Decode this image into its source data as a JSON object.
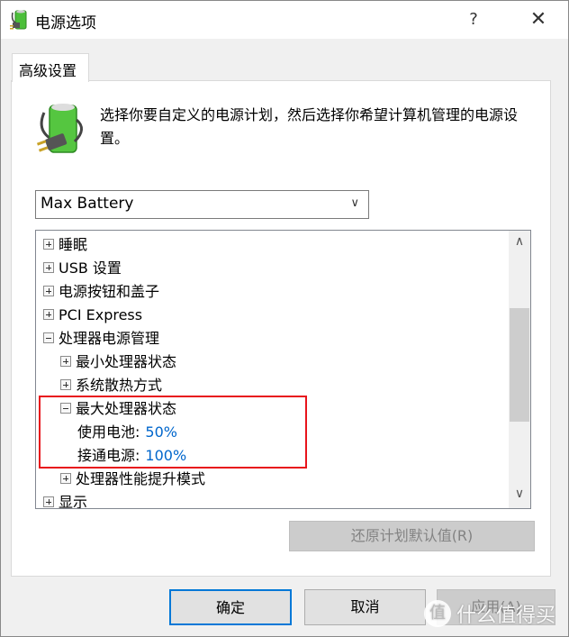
{
  "window": {
    "title": "电源选项",
    "help": "?",
    "close": "✕"
  },
  "tab": {
    "label": "高级设置"
  },
  "description": "选择你要自定义的电源计划，然后选择你希望计算机管理的电源设置。",
  "plan_select": {
    "value": "Max Battery"
  },
  "tree": [
    {
      "label": "睡眠",
      "state": "collapsed",
      "level": 0
    },
    {
      "label": "USB 设置",
      "state": "collapsed",
      "level": 0
    },
    {
      "label": "电源按钮和盖子",
      "state": "collapsed",
      "level": 0
    },
    {
      "label": "PCI Express",
      "state": "collapsed",
      "level": 0
    },
    {
      "label": "处理器电源管理",
      "state": "expanded",
      "level": 0
    },
    {
      "label": "最小处理器状态",
      "state": "collapsed",
      "level": 1
    },
    {
      "label": "系统散热方式",
      "state": "collapsed",
      "level": 1
    },
    {
      "label": "最大处理器状态",
      "state": "expanded",
      "level": 1
    },
    {
      "label": "使用电池:",
      "value": "50%",
      "level": 2
    },
    {
      "label": "接通电源:",
      "value": "100%",
      "level": 2
    },
    {
      "label": "处理器性能提升模式",
      "state": "collapsed",
      "level": 1
    },
    {
      "label": "显示",
      "state": "collapsed",
      "level": 0
    }
  ],
  "highlight_color": "#e8141c",
  "buttons": {
    "reset": "还原计划默认值(R)",
    "ok": "确定",
    "cancel": "取消",
    "apply": "应用(A)"
  },
  "watermark": {
    "icon": "值",
    "text": "什么值得买"
  }
}
